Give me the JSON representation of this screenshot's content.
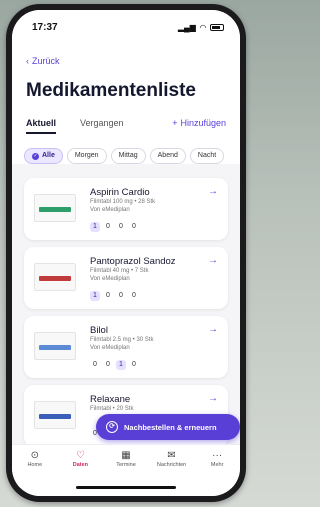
{
  "status": {
    "time": "17:37",
    "signal_icon": "signal-icon",
    "wifi_icon": "wifi-icon",
    "battery_icon": "battery-icon"
  },
  "header": {
    "back_label": "Zurück",
    "title": "Medikamentenliste",
    "tabs": [
      {
        "label": "Aktuell",
        "active": true
      },
      {
        "label": "Vergangen",
        "active": false
      }
    ],
    "add_label": "Hinzufügen"
  },
  "filters": [
    "Alle",
    "Morgen",
    "Mittag",
    "Abend",
    "Nacht"
  ],
  "active_filter": "Alle",
  "medications": [
    {
      "name": "Aspirin Cardio",
      "details": "Filmtabl 100 mg • 28 Stk",
      "source": "Von eMediplan",
      "dosage": [
        "1",
        "0",
        "0",
        "0"
      ],
      "pack_color": "#2e9e6a"
    },
    {
      "name": "Pantoprazol Sandoz",
      "details": "Filmtabl 40 mg • 7 Stk",
      "source": "Von eMediplan",
      "dosage": [
        "1",
        "0",
        "0",
        "0"
      ],
      "pack_color": "#c23b3b"
    },
    {
      "name": "Bilol",
      "details": "Filmtabl 2.5 mg • 30 Stk",
      "source": "Von eMediplan",
      "dosage": [
        "0",
        "0",
        "1",
        "0"
      ],
      "pack_color": "#5c8bd6"
    },
    {
      "name": "Relaxane",
      "details": "Filmtabl • 20 Stk",
      "source": "",
      "dosage": [
        "0"
      ],
      "pack_color": "#3a5fb8"
    }
  ],
  "fab_label": "Nachbestellen & erneuern",
  "nav": [
    {
      "label": "Home",
      "icon": "compass-icon"
    },
    {
      "label": "Daten",
      "icon": "heart-icon",
      "active": true
    },
    {
      "label": "Termine",
      "icon": "calendar-icon"
    },
    {
      "label": "Nachrichten",
      "icon": "mail-icon"
    },
    {
      "label": "Mehr",
      "icon": "more-icon"
    }
  ],
  "colors": {
    "accent": "#5a3fd6",
    "active_nav": "#d12b5a"
  }
}
